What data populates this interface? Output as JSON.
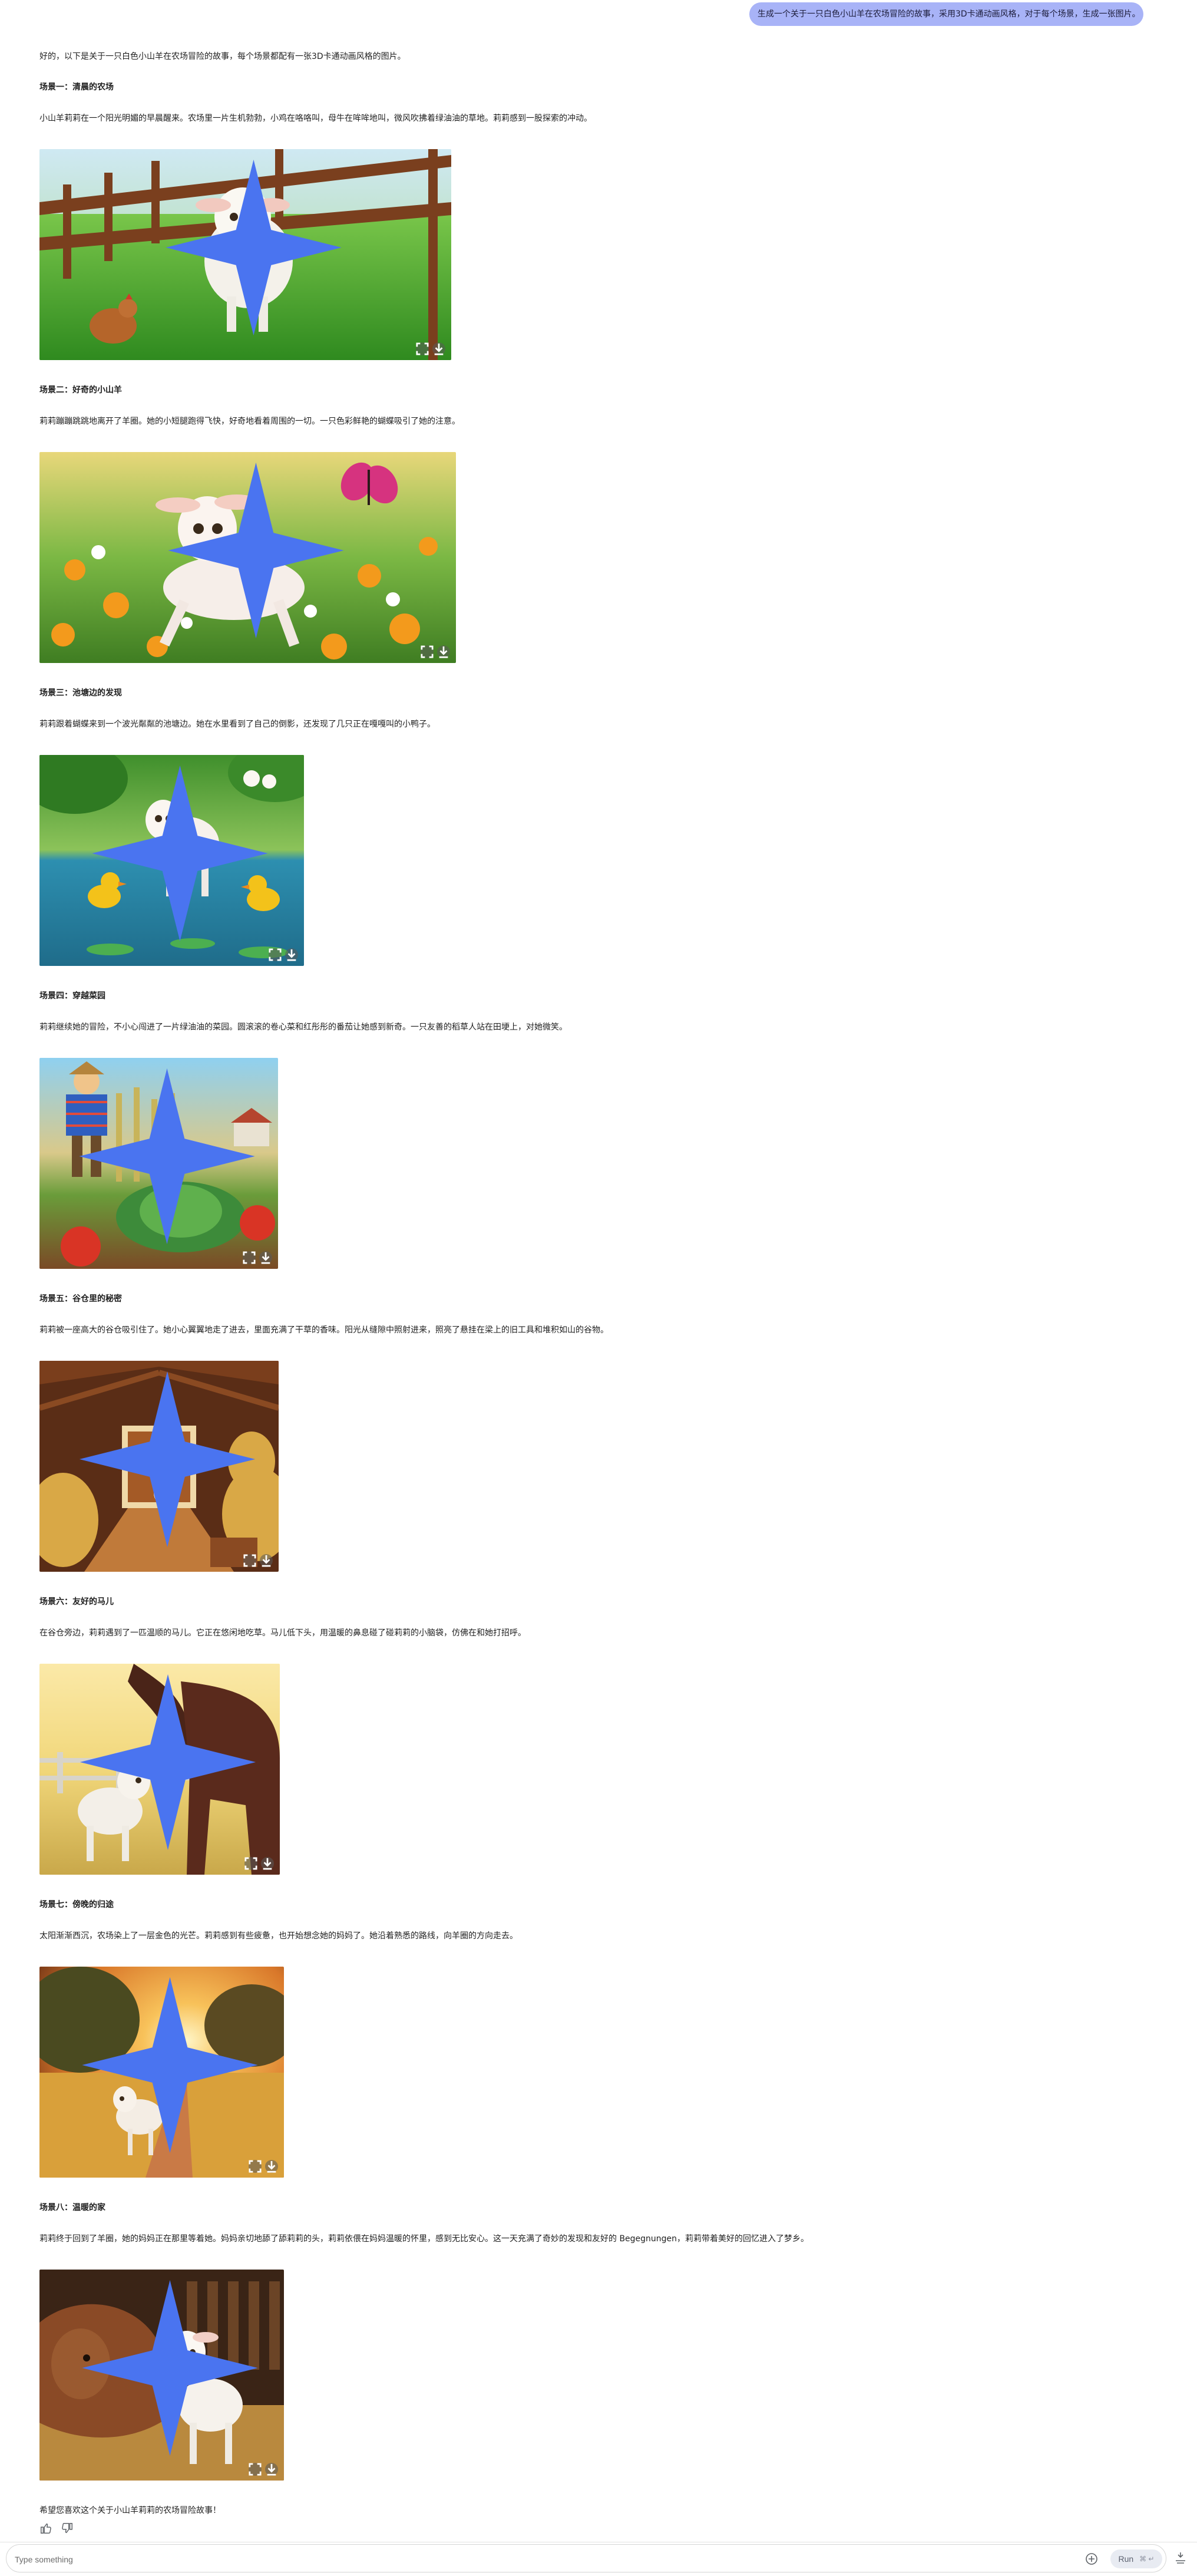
{
  "user_prompt": "生成一个关于一只白色小山羊在农场冒险的故事，采用3D卡通动画风格，对于每个场景，生成一张图片。",
  "intro": "好的，以下是关于一只白色小山羊在农场冒险的故事，每个场景都配有一张3D卡通动画风格的图片。",
  "scenes": [
    {
      "title": "场景一：清晨的农场",
      "text": "小山羊莉莉在一个阳光明媚的早晨醒来。农场里一片生机勃勃，小鸡在咯咯叫，母牛在哞哞地叫，微风吹拂着绿油油的草地。莉莉感到一股探索的冲动。"
    },
    {
      "title": "场景二：好奇的小山羊",
      "text": "莉莉蹦蹦跳跳地离开了羊圈。她的小短腿跑得飞快，好奇地看着周围的一切。一只色彩鲜艳的蝴蝶吸引了她的注意。"
    },
    {
      "title": "场景三：池塘边的发现",
      "text": "莉莉跟着蝴蝶来到一个波光粼粼的池塘边。她在水里看到了自己的倒影，还发现了几只正在嘎嘎叫的小鸭子。"
    },
    {
      "title": "场景四：穿越菜园",
      "text": "莉莉继续她的冒险，不小心闯进了一片绿油油的菜园。圆滚滚的卷心菜和红彤彤的番茄让她感到新奇。一只友善的稻草人站在田埂上，对她微笑。"
    },
    {
      "title": "场景五：谷仓里的秘密",
      "text": "莉莉被一座高大的谷仓吸引住了。她小心翼翼地走了进去，里面充满了干草的香味。阳光从缝隙中照射进来，照亮了悬挂在梁上的旧工具和堆积如山的谷物。"
    },
    {
      "title": "场景六：友好的马儿",
      "text": "在谷仓旁边，莉莉遇到了一匹温顺的马儿。它正在悠闲地吃草。马儿低下头，用温暖的鼻息碰了碰莉莉的小脑袋，仿佛在和她打招呼。"
    },
    {
      "title": "场景七：傍晚的归途",
      "text": "太阳渐渐西沉，农场染上了一层金色的光芒。莉莉感到有些疲惫，也开始想念她的妈妈了。她沿着熟悉的路线，向羊圈的方向走去。"
    },
    {
      "title": "场景八：温暖的家",
      "text": "莉莉终于回到了羊圈，她的妈妈正在那里等着她。妈妈亲切地舔了舔莉莉的头，莉莉依偎在妈妈温暖的怀里，感到无比安心。这一天充满了奇妙的发现和友好的 Begegnungen，莉莉带着美好的回忆进入了梦乡。"
    }
  ],
  "outro": "希望您喜欢这个关于小山羊莉莉的农场冒险故事！",
  "composer": {
    "placeholder": "Type something",
    "run_label": "Run",
    "run_shortcut": "⌘ ↵"
  },
  "icons": {
    "sparkle": "sparkle-icon",
    "thumb_up": "thumb-up-icon",
    "thumb_down": "thumb-down-icon",
    "add": "add-circle-icon",
    "side": "tune-icon"
  },
  "colors": {
    "user_bubble": "#a8b3f7",
    "run_button": "#e8ebf2",
    "sparkle": "#4a74f0"
  }
}
